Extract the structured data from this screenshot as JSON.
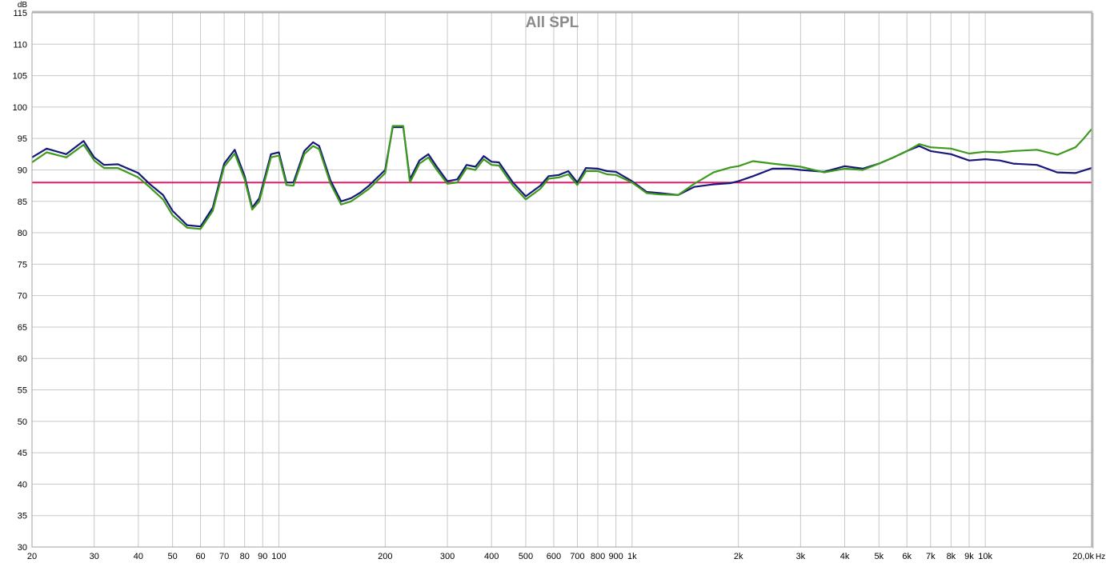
{
  "chart_data": {
    "type": "line",
    "title": "All SPL",
    "ylabel": "dB",
    "x_unit_label": "Hz",
    "x_scale": "log",
    "xlim": [
      20,
      20000
    ],
    "ylim": [
      30,
      115
    ],
    "grid": true,
    "y_ticks": [
      30,
      35,
      40,
      45,
      50,
      55,
      60,
      65,
      70,
      75,
      80,
      85,
      90,
      95,
      100,
      105,
      110,
      115
    ],
    "x_ticks": [
      {
        "v": 20,
        "label": "20"
      },
      {
        "v": 30,
        "label": "30"
      },
      {
        "v": 40,
        "label": "40"
      },
      {
        "v": 50,
        "label": "50"
      },
      {
        "v": 60,
        "label": "60"
      },
      {
        "v": 70,
        "label": "70"
      },
      {
        "v": 80,
        "label": "80"
      },
      {
        "v": 90,
        "label": "90"
      },
      {
        "v": 100,
        "label": "100"
      },
      {
        "v": 200,
        "label": "200"
      },
      {
        "v": 300,
        "label": "300"
      },
      {
        "v": 400,
        "label": "400"
      },
      {
        "v": 500,
        "label": "500"
      },
      {
        "v": 600,
        "label": "600"
      },
      {
        "v": 700,
        "label": "700"
      },
      {
        "v": 800,
        "label": "800"
      },
      {
        "v": 900,
        "label": "900"
      },
      {
        "v": 1000,
        "label": "1k"
      },
      {
        "v": 2000,
        "label": "2k"
      },
      {
        "v": 3000,
        "label": "3k"
      },
      {
        "v": 4000,
        "label": "4k"
      },
      {
        "v": 5000,
        "label": "5k"
      },
      {
        "v": 6000,
        "label": "6k"
      },
      {
        "v": 7000,
        "label": "7k"
      },
      {
        "v": 8000,
        "label": "8k"
      },
      {
        "v": 9000,
        "label": "9k"
      },
      {
        "v": 10000,
        "label": "10k"
      },
      {
        "v": 20000,
        "label": "20,0k"
      }
    ],
    "reference_line": {
      "y": 88,
      "color": "#e8196b"
    },
    "series": [
      {
        "color": "#16187a",
        "points": [
          [
            20,
            92.0
          ],
          [
            22,
            93.4
          ],
          [
            25,
            92.5
          ],
          [
            28,
            94.6
          ],
          [
            30,
            92.0
          ],
          [
            32,
            90.8
          ],
          [
            35,
            90.9
          ],
          [
            40,
            89.5
          ],
          [
            43,
            87.8
          ],
          [
            47,
            86.0
          ],
          [
            50,
            83.5
          ],
          [
            55,
            81.2
          ],
          [
            60,
            81.0
          ],
          [
            65,
            84.0
          ],
          [
            70,
            91.0
          ],
          [
            75,
            93.2
          ],
          [
            80,
            89.0
          ],
          [
            84,
            84.0
          ],
          [
            88,
            85.5
          ],
          [
            95,
            92.5
          ],
          [
            100,
            92.8
          ],
          [
            105,
            88.0
          ],
          [
            110,
            88.0
          ],
          [
            118,
            93.0
          ],
          [
            125,
            94.4
          ],
          [
            130,
            93.8
          ],
          [
            140,
            88.3
          ],
          [
            150,
            85.0
          ],
          [
            160,
            85.5
          ],
          [
            170,
            86.4
          ],
          [
            180,
            87.5
          ],
          [
            200,
            90.0
          ],
          [
            210,
            96.8
          ],
          [
            225,
            96.8
          ],
          [
            235,
            88.5
          ],
          [
            250,
            91.5
          ],
          [
            265,
            92.5
          ],
          [
            280,
            90.5
          ],
          [
            300,
            88.2
          ],
          [
            320,
            88.5
          ],
          [
            340,
            90.8
          ],
          [
            360,
            90.5
          ],
          [
            380,
            92.2
          ],
          [
            400,
            91.3
          ],
          [
            420,
            91.2
          ],
          [
            460,
            88.0
          ],
          [
            500,
            85.8
          ],
          [
            550,
            87.5
          ],
          [
            580,
            89.0
          ],
          [
            620,
            89.2
          ],
          [
            660,
            89.8
          ],
          [
            700,
            88.0
          ],
          [
            740,
            90.3
          ],
          [
            800,
            90.2
          ],
          [
            850,
            89.8
          ],
          [
            900,
            89.7
          ],
          [
            1000,
            88.2
          ],
          [
            1100,
            86.5
          ],
          [
            1200,
            86.3
          ],
          [
            1350,
            86.0
          ],
          [
            1500,
            87.3
          ],
          [
            1700,
            87.7
          ],
          [
            1900,
            87.9
          ],
          [
            2000,
            88.2
          ],
          [
            2200,
            89.0
          ],
          [
            2500,
            90.2
          ],
          [
            2800,
            90.2
          ],
          [
            3000,
            90.0
          ],
          [
            3500,
            89.7
          ],
          [
            4000,
            90.6
          ],
          [
            4500,
            90.2
          ],
          [
            5000,
            91.0
          ],
          [
            5500,
            92.0
          ],
          [
            6000,
            93.0
          ],
          [
            6500,
            93.8
          ],
          [
            7000,
            93.0
          ],
          [
            8000,
            92.5
          ],
          [
            9000,
            91.5
          ],
          [
            10000,
            91.7
          ],
          [
            11000,
            91.5
          ],
          [
            12000,
            91.0
          ],
          [
            14000,
            90.8
          ],
          [
            16000,
            89.6
          ],
          [
            18000,
            89.5
          ],
          [
            20000,
            90.3
          ]
        ]
      },
      {
        "color": "#3d9a1c",
        "points": [
          [
            20,
            91.2
          ],
          [
            22,
            92.8
          ],
          [
            25,
            92.0
          ],
          [
            28,
            94.0
          ],
          [
            30,
            91.5
          ],
          [
            32,
            90.3
          ],
          [
            35,
            90.3
          ],
          [
            40,
            88.8
          ],
          [
            43,
            87.3
          ],
          [
            47,
            85.3
          ],
          [
            50,
            82.8
          ],
          [
            55,
            80.8
          ],
          [
            60,
            80.6
          ],
          [
            65,
            83.5
          ],
          [
            70,
            90.5
          ],
          [
            75,
            92.6
          ],
          [
            80,
            88.5
          ],
          [
            84,
            83.7
          ],
          [
            88,
            85.0
          ],
          [
            95,
            92.0
          ],
          [
            100,
            92.3
          ],
          [
            105,
            87.6
          ],
          [
            110,
            87.5
          ],
          [
            118,
            92.5
          ],
          [
            125,
            93.8
          ],
          [
            130,
            93.3
          ],
          [
            140,
            87.8
          ],
          [
            150,
            84.5
          ],
          [
            160,
            85.0
          ],
          [
            170,
            86.0
          ],
          [
            180,
            87.0
          ],
          [
            200,
            89.5
          ],
          [
            210,
            97.0
          ],
          [
            225,
            97.0
          ],
          [
            235,
            88.0
          ],
          [
            250,
            91.0
          ],
          [
            265,
            92.0
          ],
          [
            280,
            90.0
          ],
          [
            300,
            87.8
          ],
          [
            320,
            88.0
          ],
          [
            340,
            90.3
          ],
          [
            360,
            90.0
          ],
          [
            380,
            91.7
          ],
          [
            400,
            90.8
          ],
          [
            420,
            90.7
          ],
          [
            460,
            87.5
          ],
          [
            500,
            85.3
          ],
          [
            550,
            87.0
          ],
          [
            580,
            88.6
          ],
          [
            620,
            88.8
          ],
          [
            660,
            89.3
          ],
          [
            700,
            87.6
          ],
          [
            740,
            89.8
          ],
          [
            800,
            89.8
          ],
          [
            850,
            89.3
          ],
          [
            900,
            89.2
          ],
          [
            1000,
            88.0
          ],
          [
            1100,
            86.3
          ],
          [
            1200,
            86.1
          ],
          [
            1350,
            86.0
          ],
          [
            1500,
            87.8
          ],
          [
            1700,
            89.6
          ],
          [
            1900,
            90.4
          ],
          [
            2000,
            90.6
          ],
          [
            2200,
            91.4
          ],
          [
            2500,
            91.0
          ],
          [
            2800,
            90.7
          ],
          [
            3000,
            90.5
          ],
          [
            3500,
            89.6
          ],
          [
            4000,
            90.2
          ],
          [
            4500,
            90.0
          ],
          [
            5000,
            91.0
          ],
          [
            5500,
            92.0
          ],
          [
            6000,
            93.0
          ],
          [
            6500,
            94.1
          ],
          [
            7000,
            93.6
          ],
          [
            8000,
            93.4
          ],
          [
            9000,
            92.6
          ],
          [
            10000,
            92.9
          ],
          [
            11000,
            92.8
          ],
          [
            12000,
            93.0
          ],
          [
            14000,
            93.2
          ],
          [
            16000,
            92.4
          ],
          [
            18000,
            93.6
          ],
          [
            19000,
            95.0
          ],
          [
            20000,
            96.5
          ]
        ]
      }
    ]
  }
}
